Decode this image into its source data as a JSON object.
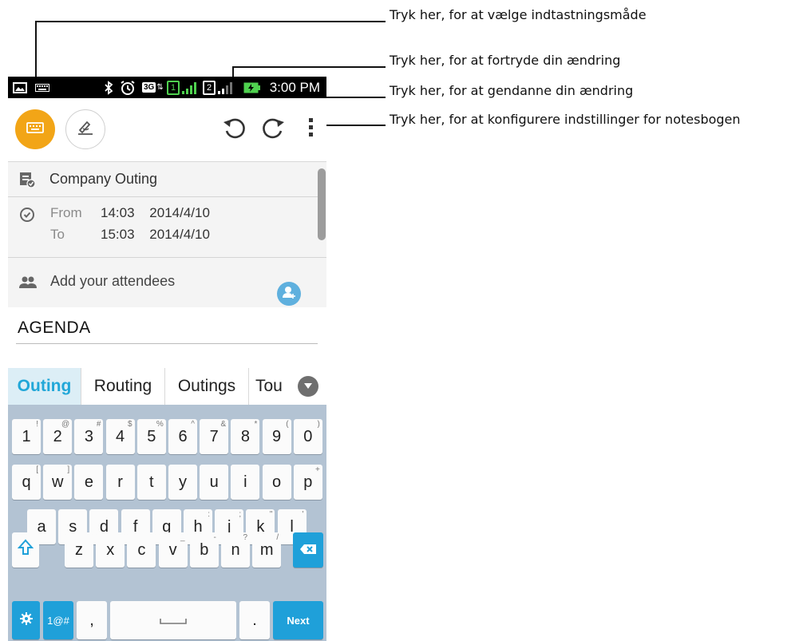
{
  "callouts": [
    "Tryk her, for at vælge indtastningsmåde",
    "Tryk her, for at fortryde din ændring",
    "Tryk her, for at gendanne din ændring",
    "Tryk her, for at konfigurere indstillinger for notesbogen"
  ],
  "status_bar": {
    "network": "3G",
    "sim1": "1",
    "sim2": "2",
    "time": "3:00 PM",
    "icons": [
      "image-icon",
      "keyboard-icon",
      "bluetooth-icon",
      "alarm-icon",
      "data-3g-icon",
      "sim1-icon",
      "signal-icon",
      "sim2-icon",
      "signal-icon",
      "battery-charging-icon"
    ]
  },
  "toolbar": {
    "icons": [
      "keyboard-icon",
      "handwriting-icon",
      "undo-icon",
      "redo-icon",
      "overflow-menu-icon"
    ],
    "accent": "#f2a517"
  },
  "event": {
    "title": "Company Outing",
    "from_label": "From",
    "from_time": "14:03",
    "from_date": "2014/4/10",
    "to_label": "To",
    "to_time": "15:03",
    "to_date": "2014/4/10",
    "attendees_placeholder": "Add your attendees",
    "note_text": "AGENDA"
  },
  "suggestions": [
    "Outing",
    "Routing",
    "Outings",
    "Tou"
  ],
  "keyboard": {
    "row1": [
      {
        "k": "1",
        "h": "!"
      },
      {
        "k": "2",
        "h": "@"
      },
      {
        "k": "3",
        "h": "#"
      },
      {
        "k": "4",
        "h": "$"
      },
      {
        "k": "5",
        "h": "%"
      },
      {
        "k": "6",
        "h": "^"
      },
      {
        "k": "7",
        "h": "&"
      },
      {
        "k": "8",
        "h": "*"
      },
      {
        "k": "9",
        "h": "("
      },
      {
        "k": "0",
        "h": ")"
      }
    ],
    "row2": [
      {
        "k": "q",
        "h": "["
      },
      {
        "k": "w",
        "h": "]"
      },
      {
        "k": "e",
        "h": ""
      },
      {
        "k": "r",
        "h": ""
      },
      {
        "k": "t",
        "h": ""
      },
      {
        "k": "y",
        "h": ""
      },
      {
        "k": "u",
        "h": ""
      },
      {
        "k": "i",
        "h": ""
      },
      {
        "k": "o",
        "h": ""
      },
      {
        "k": "p",
        "h": "+"
      }
    ],
    "row3": [
      {
        "k": "a",
        "h": ""
      },
      {
        "k": "s",
        "h": ""
      },
      {
        "k": "d",
        "h": ""
      },
      {
        "k": "f",
        "h": ""
      },
      {
        "k": "g",
        "h": ""
      },
      {
        "k": "h",
        "h": ":"
      },
      {
        "k": "j",
        "h": ";"
      },
      {
        "k": "k",
        "h": "\""
      },
      {
        "k": "l",
        "h": "'"
      }
    ],
    "row4": [
      {
        "k": "z",
        "h": ""
      },
      {
        "k": "x",
        "h": ""
      },
      {
        "k": "c",
        "h": ""
      },
      {
        "k": "v",
        "h": "_"
      },
      {
        "k": "b",
        "h": "-"
      },
      {
        "k": "n",
        "h": "?"
      },
      {
        "k": "m",
        "h": "/"
      }
    ],
    "symbols_label": "1@#",
    "comma_label": ",",
    "period_label": ".",
    "next_label": "Next",
    "accent": "#1fa0d9"
  }
}
